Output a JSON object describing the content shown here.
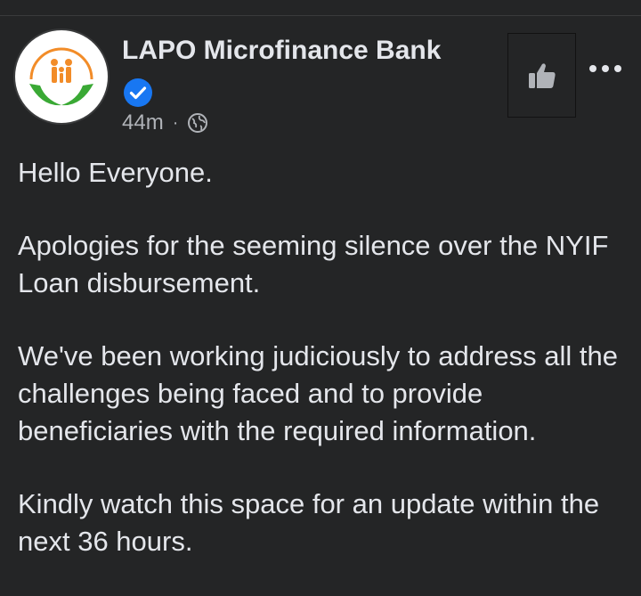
{
  "post": {
    "page_name": "LAPO Microfinance Bank",
    "timestamp": "44m",
    "separator": "·",
    "privacy_icon": "globe-icon",
    "verified_icon": "verified-badge-icon",
    "like_icon": "thumbs-up-icon",
    "more_icon": "more-options-icon",
    "paragraphs": [
      "Hello Everyone.",
      "Apologies for the seeming silence over the NYIF Loan disbursement.",
      "We've been working judiciously to address all the challenges being faced and to provide beneficiaries with the required information.",
      "Kindly watch this space for an update within the next 36 hours."
    ]
  },
  "colors": {
    "background": "#242526",
    "text_primary": "#e4e6eb",
    "text_secondary": "#b0b3b8",
    "verified_blue": "#1877f2",
    "logo_orange": "#f28c28",
    "logo_green": "#3aa935"
  }
}
